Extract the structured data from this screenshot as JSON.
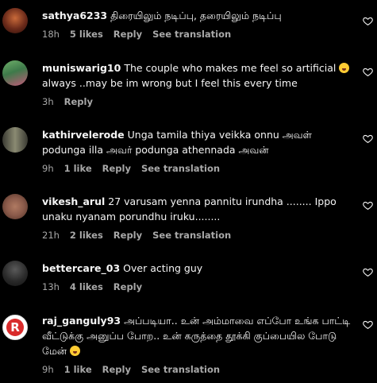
{
  "colors": {
    "background": "#000000",
    "text": "#f5f5f5",
    "meta": "#a8a8a8",
    "emoji": "#ffcc33"
  },
  "icons": {
    "like": "heart-outline-icon",
    "emoji_laugh": "grinning-emoji-icon"
  },
  "comments": [
    {
      "username": "sathya6233",
      "text": "திரையிலும் நடிப்பு, தரையிலும் நடிப்பு",
      "time": "18h",
      "likes": "5 likes",
      "reply": "Reply",
      "translate": "See translation",
      "avatar_color": "#6b2a1a"
    },
    {
      "username": "muniswarig10",
      "text": "The couple who makes me feel so artificial",
      "text2": "always ..may be im wrong but I feel this every time",
      "time": "3h",
      "reply": "Reply",
      "avatar_color": "#3e7a4a"
    },
    {
      "username": "kathirvelerode",
      "text": "Unga tamila thiya veikka onnu அவள் podunga illa அவர் podunga athennada அவன்",
      "time": "9h",
      "likes": "1 like",
      "reply": "Reply",
      "translate": "See translation",
      "avatar_color": "#5a5a4a"
    },
    {
      "username": "vikesh_arul",
      "text": "27 varusam yenna pannitu irundha ........ Ippo unaku nyanam porundhu iruku........",
      "time": "21h",
      "likes": "2 likes",
      "reply": "Reply",
      "translate": "See translation",
      "avatar_color": "#8a5a4a"
    },
    {
      "username": "bettercare_03",
      "text": "Over acting guy",
      "time": "13h",
      "likes": "4 likes",
      "reply": "Reply",
      "avatar_color": "#2a2a2a"
    },
    {
      "username": "raj_ganguly93",
      "text": "அப்படியா.. உன் அம்மாவை எப்போ உங்க பாட்டி வீட்டுக்கு அனுப்ப போற.. உன் கருத்தை தூக்கி குப்பையில போடு மேன்",
      "time": "9h",
      "likes": "1 like",
      "reply": "Reply",
      "translate": "See translation",
      "avatar_letter": "R",
      "avatar_color": "#d92b2b"
    }
  ]
}
